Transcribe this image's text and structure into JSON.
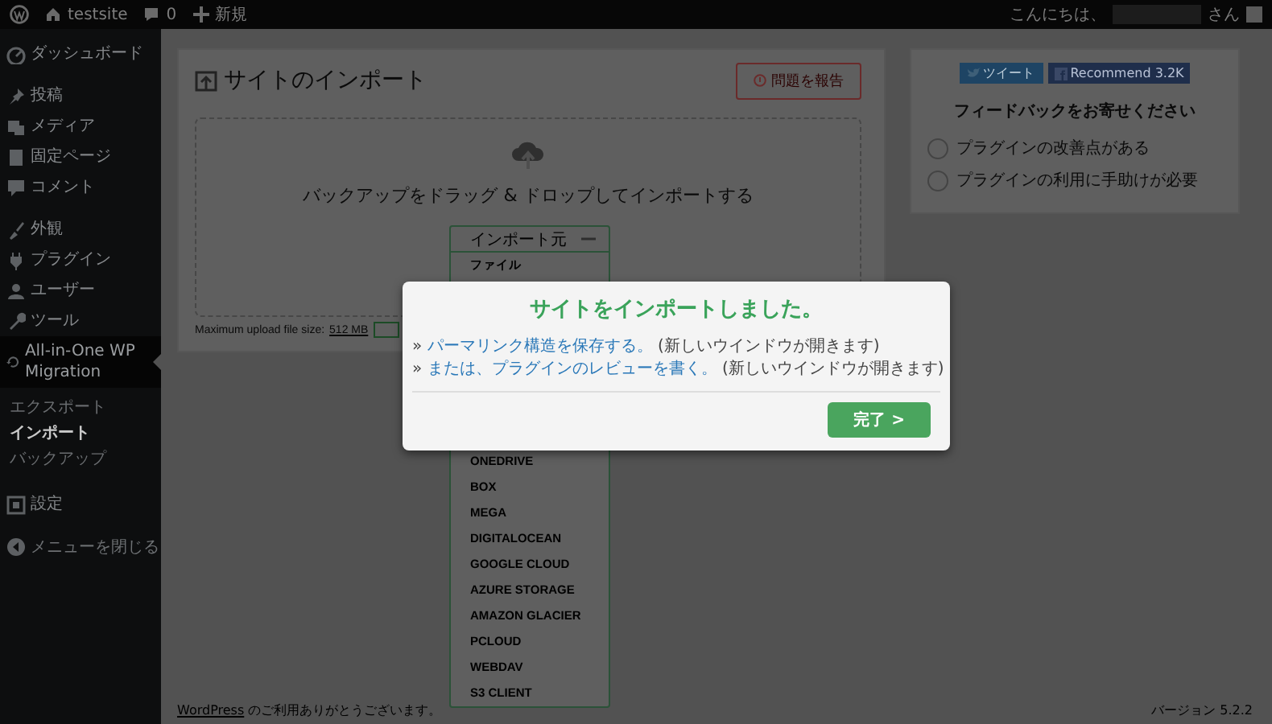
{
  "admin_bar": {
    "site_name": "testsite",
    "comment_count": "0",
    "new_label": "新規",
    "greeting": "こんにちは、",
    "greeting_suffix": "さん"
  },
  "sidebar": {
    "groups": [
      {
        "items": [
          {
            "label": "ダッシュボード",
            "selected": false
          }
        ]
      },
      {
        "items": [
          {
            "label": "投稿",
            "selected": false
          },
          {
            "label": "メディア",
            "selected": false
          },
          {
            "label": "固定ページ",
            "selected": false
          },
          {
            "label": "コメント",
            "selected": false
          }
        ]
      },
      {
        "items": [
          {
            "label": "外観",
            "selected": false
          },
          {
            "label": "プラグイン",
            "selected": false
          },
          {
            "label": "ユーザー",
            "selected": false
          },
          {
            "label": "ツール",
            "selected": false
          },
          {
            "label": "All-in-One WP Migration",
            "selected": true,
            "children": [
              {
                "label": "エクスポート",
                "selected": false
              },
              {
                "label": "インポート",
                "selected": true
              },
              {
                "label": "バックアップ",
                "selected": false
              }
            ]
          }
        ]
      },
      {
        "items": [
          {
            "label": "設定",
            "selected": false
          }
        ]
      }
    ],
    "collapse_label": "メニューを閉じる"
  },
  "import_panel": {
    "title": "サイトのインポート",
    "report_button": "問題を報告",
    "drop_text": "バックアップをドラッグ & ドロップしてインポートする",
    "max_upload_label": "Maximum upload file size:",
    "max_upload_value": "512 MB",
    "source_menu": {
      "label": "インポート元",
      "items": [
        "ファイル",
        "ONEDRIVE",
        "BOX",
        "MEGA",
        "DIGITALOCEAN",
        "GOOGLE CLOUD",
        "AZURE STORAGE",
        "AMAZON GLACIER",
        "PCLOUD",
        "WEBDAV",
        "S3 CLIENT"
      ]
    }
  },
  "feedback": {
    "tweet_button": "ツイート",
    "recommend_button": "Recommend",
    "recommend_count": "3.2K",
    "heading": "フィードバックをお寄せください",
    "options": [
      {
        "label": "プラグインの改善点がある",
        "selected": false
      },
      {
        "label": "プラグインの利用に手助けが必要",
        "selected": false
      }
    ]
  },
  "dialog": {
    "title": "サイトをインポートしました。",
    "lines": [
      {
        "prefix": "»",
        "link": "パーマリンク構造を保存する。",
        "note": "(新しいウインドウが開きます)"
      },
      {
        "prefix": "»",
        "link": "または、プラグインのレビューを書く。",
        "note": "(新しいウインドウが開きます)"
      }
    ],
    "done_button": "完了 >"
  },
  "footer": {
    "link": "WordPress",
    "text": "のご利用ありがとうございます。",
    "version": "バージョン 5.2.2"
  }
}
